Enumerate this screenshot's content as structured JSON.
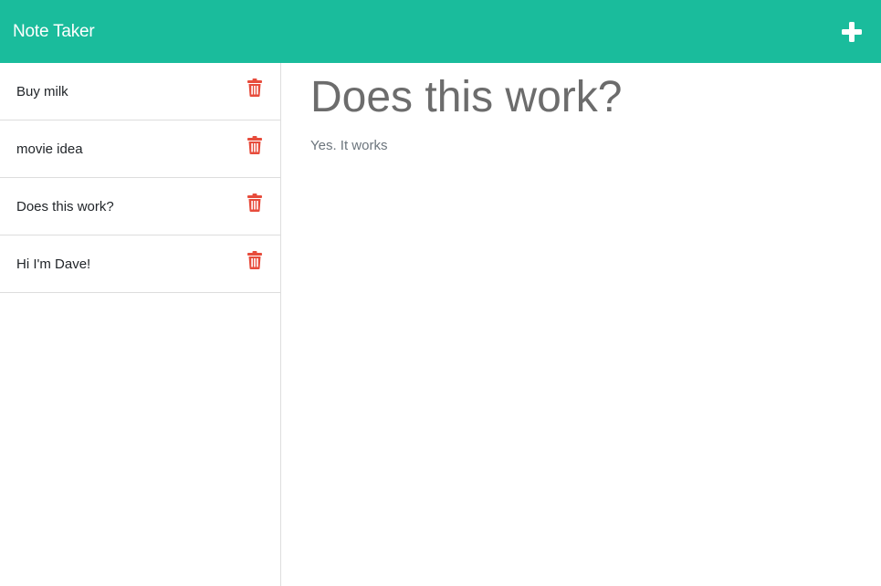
{
  "header": {
    "title": "Note Taker",
    "new_note_icon": "plus-icon"
  },
  "notes": [
    {
      "title": "Buy milk",
      "icon": "trash-icon"
    },
    {
      "title": "movie idea",
      "icon": "trash-icon"
    },
    {
      "title": "Does this work?",
      "icon": "trash-icon"
    },
    {
      "title": "Hi I'm Dave!",
      "icon": "trash-icon"
    }
  ],
  "active_note": {
    "title": "Does this work?",
    "text": "Yes. It works"
  },
  "colors": {
    "brand": "#1abc9c",
    "danger": "#e74c3c"
  }
}
